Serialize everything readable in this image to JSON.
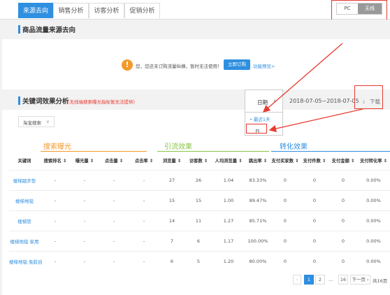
{
  "tabs": [
    "来源去向",
    "销售分析",
    "访客分析",
    "促销分析"
  ],
  "device_toggle": {
    "pc": "PC",
    "wireless": "无线"
  },
  "section1_title": "商品流量来源去向",
  "notice": {
    "text": "您，您还未订购流量纵横，暂时无法使用！",
    "button": "立即订购",
    "link": "功能预览>"
  },
  "section2": {
    "title": "关键词效果分析",
    "warning": "（无线端搜索曝光指标暂无法提供）"
  },
  "date_dropdown": {
    "label": "日期",
    "caret": "∧",
    "menu": [
      "• 最近1天",
      "日"
    ]
  },
  "date_range": "2018-07-05~2018-07-05",
  "download": "下载",
  "download_icon": "⤓",
  "source_select": {
    "value": "淘宝搜索",
    "caret": "∨"
  },
  "groups": {
    "search": "搜索曝光",
    "traffic": "引流效果",
    "conversion": "转化效果"
  },
  "colors": {
    "accent": "#2f8fe0",
    "search": "#f39a2a",
    "traffic": "#8bc34a",
    "annotation": "#e8392f"
  },
  "table": {
    "headers": [
      "关键词",
      "搜索排名 ⇕",
      "曝光量 ⇕",
      "点击量 ⇕",
      "点击率 ⇕",
      "浏览量 ⇕",
      "访客数 ⇕",
      "人均浏览量 ⇕",
      "跳出率 ⇕",
      "支付买家数 ⇕",
      "支付件数 ⇕",
      "支付金额 ⇕",
      "支付转化率 ⇕"
    ],
    "rows": [
      [
        "楼梯踏步垫",
        "-",
        "-",
        "-",
        "-",
        "27",
        "26",
        "1.04",
        "83.33%",
        "0",
        "0",
        "0",
        "0.00%"
      ],
      [
        "楼梯地毯",
        "-",
        "-",
        "-",
        "-",
        "15",
        "15",
        "1.00",
        "89.47%",
        "0",
        "0",
        "0",
        "0.00%"
      ],
      [
        "楼梯垫",
        "-",
        "-",
        "-",
        "-",
        "14",
        "11",
        "1.27",
        "85.71%",
        "0",
        "0",
        "0",
        "0.00%"
      ],
      [
        "楼梯地毯 家用",
        "-",
        "-",
        "-",
        "-",
        "7",
        "6",
        "1.17",
        "100.00%",
        "0",
        "0",
        "0",
        "0.00%"
      ],
      [
        "楼梯地毯 免胶自",
        "-",
        "-",
        "-",
        "-",
        "6",
        "5",
        "1.20",
        "80.00%",
        "0",
        "0",
        "0",
        "0.00%"
      ]
    ]
  },
  "pagination": {
    "prev": "‹",
    "pages": [
      "1",
      "2",
      "...",
      "16"
    ],
    "next": "下一页 ›",
    "total": "共16页"
  }
}
